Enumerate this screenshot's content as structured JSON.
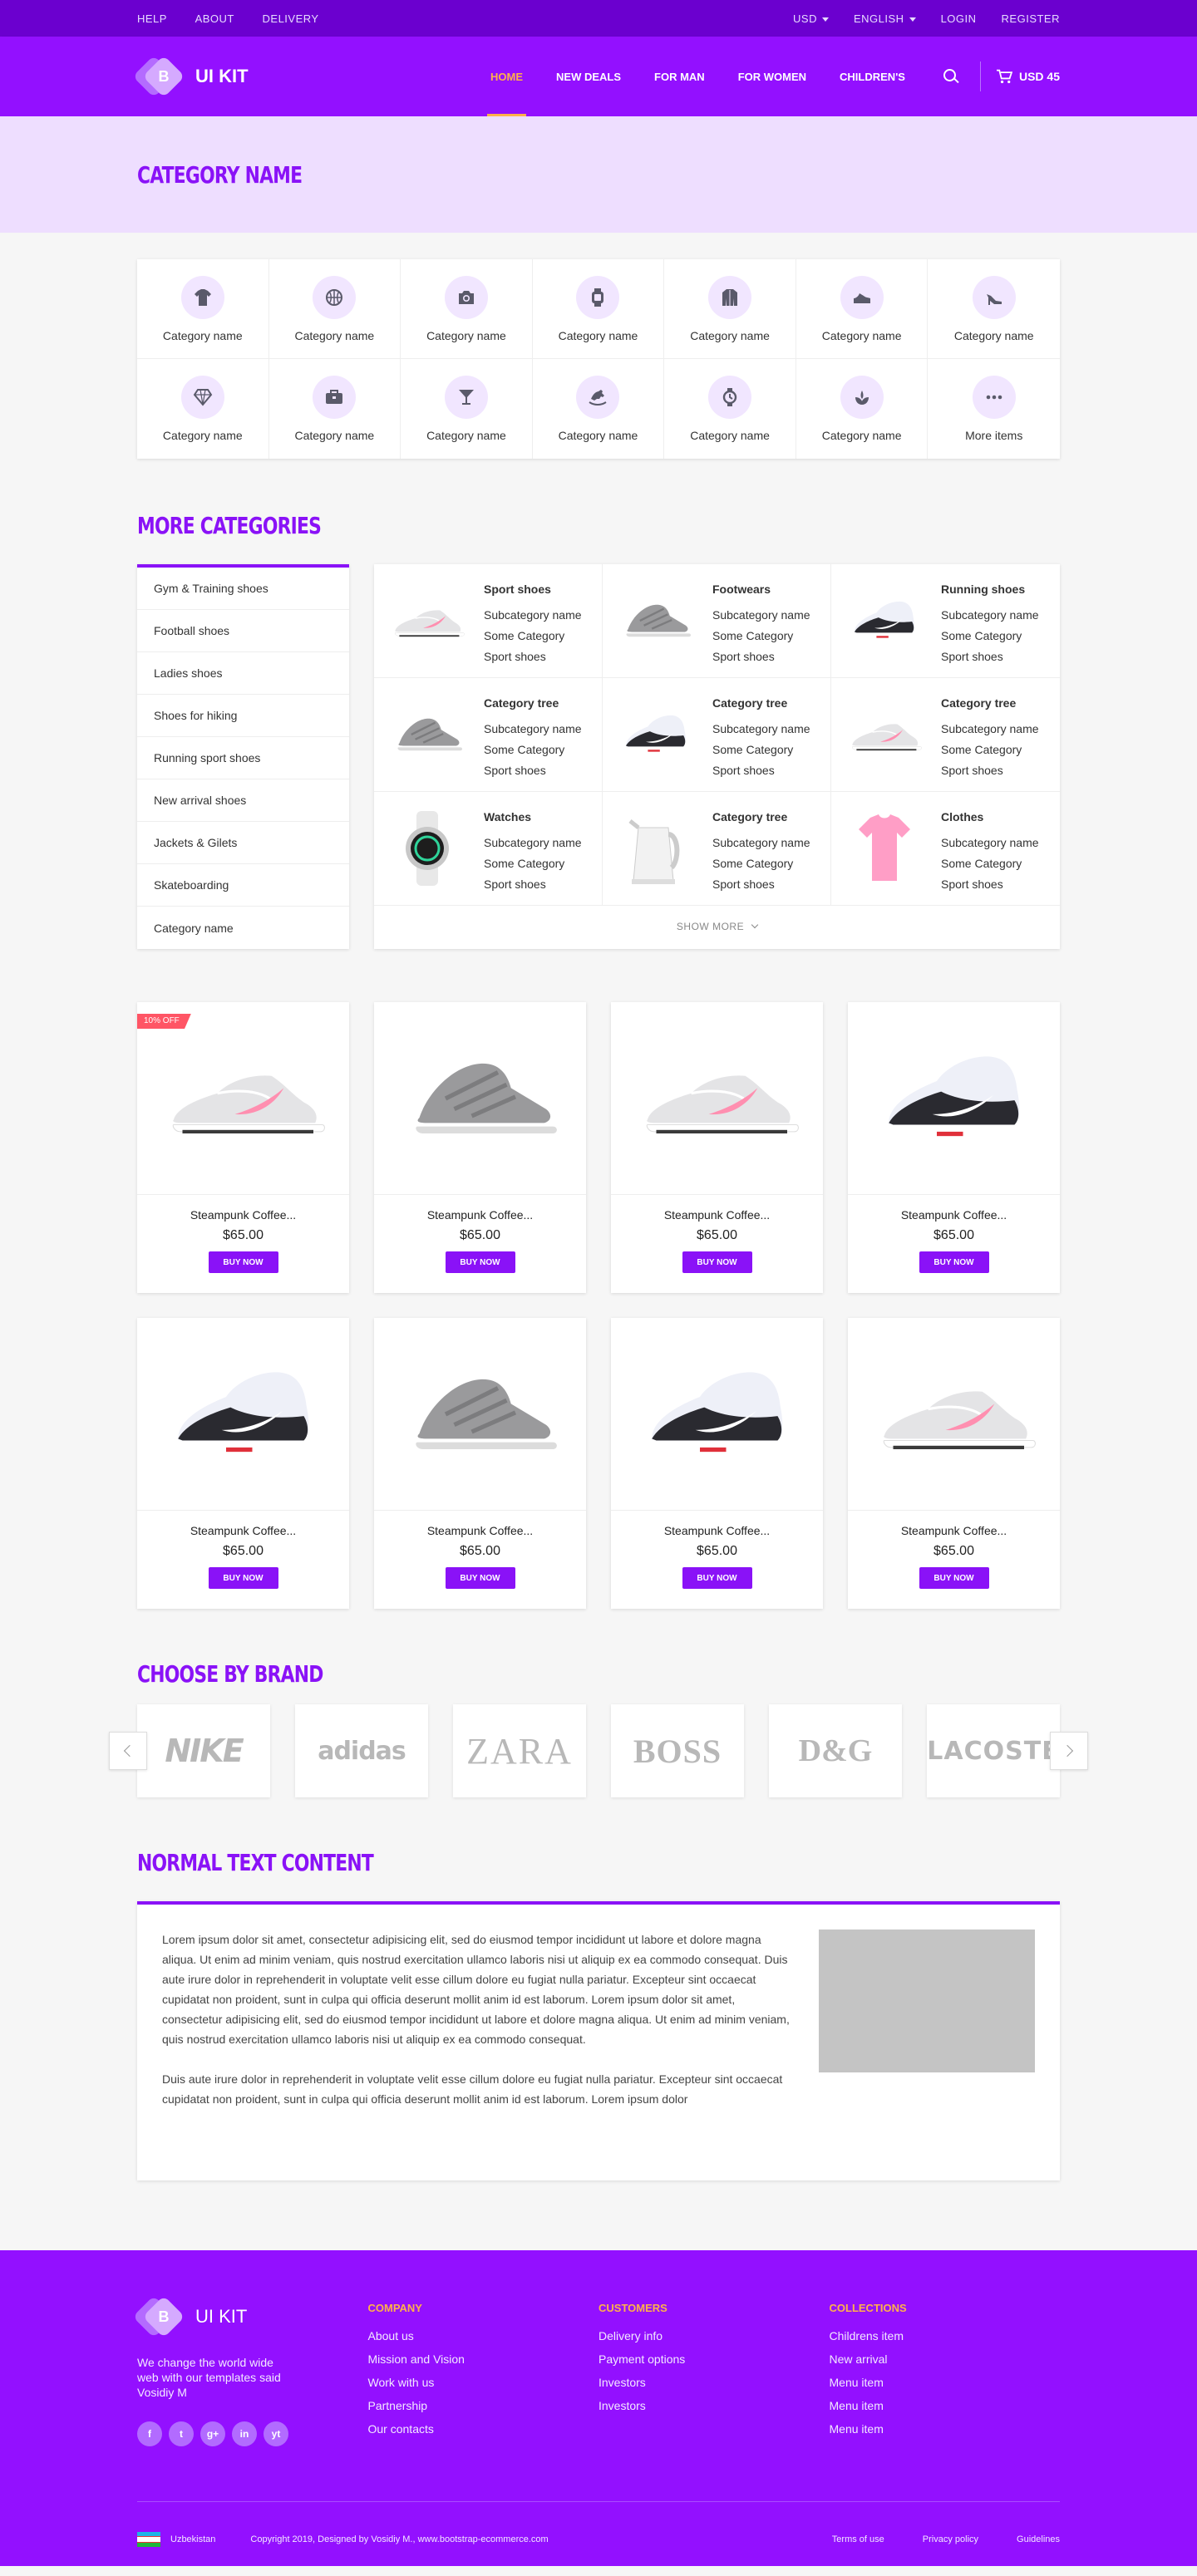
{
  "topbar": {
    "left": [
      "HELP",
      "ABOUT",
      "DELIVERY"
    ],
    "currency": "USD",
    "language": "ENGLISH",
    "login": "LOGIN",
    "register": "REGISTER"
  },
  "header": {
    "logo_letter": "B",
    "logo_text": "UI KIT",
    "nav": [
      "HOME",
      "NEW DEALS",
      "FOR MAN",
      "FOR WOMEN",
      "CHILDREN'S"
    ],
    "active_nav": "HOME",
    "cart_total": "USD 45"
  },
  "banner": {
    "title": "CATEGORY NAME"
  },
  "categories": [
    {
      "label": "Category name",
      "icon": "tshirt-icon"
    },
    {
      "label": "Category name",
      "icon": "basketball-icon"
    },
    {
      "label": "Category name",
      "icon": "camera-icon"
    },
    {
      "label": "Category name",
      "icon": "smartwatch-icon"
    },
    {
      "label": "Category name",
      "icon": "jacket-icon"
    },
    {
      "label": "Category name",
      "icon": "shoe-icon"
    },
    {
      "label": "Category name",
      "icon": "high-heel-icon"
    },
    {
      "label": "Category name",
      "icon": "diamond-icon"
    },
    {
      "label": "Category name",
      "icon": "briefcase-icon"
    },
    {
      "label": "Category name",
      "icon": "cocktail-icon"
    },
    {
      "label": "Category name",
      "icon": "rocking-horse-icon"
    },
    {
      "label": "Category name",
      "icon": "wristwatch-icon"
    },
    {
      "label": "Category name",
      "icon": "plant-icon"
    },
    {
      "label": "More items",
      "icon": "more-icon"
    }
  ],
  "more_categories": {
    "title": "MORE CATEGORIES",
    "sidebar": [
      "Gym & Training shoes",
      "Football  shoes",
      "Ladies shoes",
      "Shoes for hiking",
      "Running sport shoes",
      "New arrival shoes",
      "Jackets & Gilets",
      "Skateboarding",
      "Category name"
    ],
    "cells": [
      {
        "title": "Sport shoes",
        "lines": [
          "Subcategory name",
          "Some Category",
          "Sport shoes"
        ],
        "img": "sneaker-white"
      },
      {
        "title": "Footwears",
        "lines": [
          "Subcategory name",
          "Some Category",
          "Sport shoes"
        ],
        "img": "sneaker-grey"
      },
      {
        "title": "Running shoes",
        "lines": [
          "Subcategory name",
          "Some Category",
          "Sport shoes"
        ],
        "img": "sneaker-black"
      },
      {
        "title": "Category tree",
        "lines": [
          "Subcategory name",
          "Some Category",
          "Sport shoes"
        ],
        "img": "sneaker-grey"
      },
      {
        "title": "Category tree",
        "lines": [
          "Subcategory name",
          "Some Category",
          "Sport shoes"
        ],
        "img": "sneaker-black"
      },
      {
        "title": "Category tree",
        "lines": [
          "Subcategory name",
          "Some Category",
          "Sport shoes"
        ],
        "img": "sneaker-white"
      },
      {
        "title": "Watches",
        "lines": [
          "Subcategory name",
          "Some Category",
          "Sport shoes"
        ],
        "img": "watch"
      },
      {
        "title": "Category tree",
        "lines": [
          "Subcategory name",
          "Some Category",
          "Sport shoes"
        ],
        "img": "kettle"
      },
      {
        "title": "Clothes",
        "lines": [
          "Subcategory name",
          "Some Category",
          "Sport shoes"
        ],
        "img": "tshirt"
      }
    ],
    "show_more": "SHOW MORE"
  },
  "products": [
    {
      "name": "Steampunk Coffee...",
      "price": "$65.00",
      "button": "BUY NOW",
      "badge": "10% OFF",
      "img": "sneaker-white"
    },
    {
      "name": "Steampunk Coffee...",
      "price": "$65.00",
      "button": "BUY NOW",
      "badge": "",
      "img": "sneaker-grey"
    },
    {
      "name": "Steampunk Coffee...",
      "price": "$65.00",
      "button": "BUY NOW",
      "badge": "",
      "img": "sneaker-white"
    },
    {
      "name": "Steampunk Coffee...",
      "price": "$65.00",
      "button": "BUY NOW",
      "badge": "",
      "img": "sneaker-black"
    },
    {
      "name": "Steampunk Coffee...",
      "price": "$65.00",
      "button": "BUY NOW",
      "badge": "",
      "img": "sneaker-black"
    },
    {
      "name": "Steampunk Coffee...",
      "price": "$65.00",
      "button": "BUY NOW",
      "badge": "",
      "img": "sneaker-grey"
    },
    {
      "name": "Steampunk Coffee...",
      "price": "$65.00",
      "button": "BUY NOW",
      "badge": "",
      "img": "sneaker-black"
    },
    {
      "name": "Steampunk Coffee...",
      "price": "$65.00",
      "button": "BUY NOW",
      "badge": "",
      "img": "sneaker-white"
    }
  ],
  "brands": {
    "title": "CHOOSE BY BRAND",
    "items": [
      "NIKE",
      "adidas",
      "ZARA",
      "BOSS",
      "D&G",
      "LACOSTE"
    ]
  },
  "text_content": {
    "title": "NORMAL TEXT CONTENT",
    "p1": "Lorem ipsum dolor sit amet, consectetur adipisicing elit, sed do eiusmod tempor incididunt ut labore et dolore magna aliqua. Ut enim ad minim veniam, quis nostrud exercitation ullamco laboris nisi ut aliquip ex ea commodo consequat. Duis aute irure dolor in reprehenderit in voluptate velit esse cillum dolore eu fugiat nulla pariatur. Excepteur sint occaecat cupidatat non proident, sunt in culpa qui officia deserunt mollit anim id est laborum. Lorem ipsum dolor sit amet, consectetur adipisicing elit, sed do eiusmod tempor incididunt ut labore et dolore magna aliqua. Ut enim ad minim veniam, quis nostrud exercitation ullamco laboris nisi ut aliquip ex ea commodo consequat.",
    "p2": "Duis aute irure dolor in reprehenderit in voluptate velit esse cillum dolore eu fugiat nulla pariatur. Excepteur sint occaecat cupidatat non proident, sunt in culpa qui officia deserunt mollit anim id est laborum. Lorem ipsum dolor"
  },
  "footer": {
    "logo_text": "UI KIT",
    "description": "We change the world wide web with our templates said Vosidiy M",
    "socials": [
      "f",
      "t",
      "g+",
      "in",
      "yt"
    ],
    "columns": [
      {
        "heading": "COMPANY",
        "links": [
          "About us",
          "Mission and Vision",
          "Work with us",
          "Partnership",
          "Our contacts"
        ]
      },
      {
        "heading": "CUSTOMERS",
        "links": [
          "Delivery info",
          "Payment options",
          "Investors",
          "Investors"
        ]
      },
      {
        "heading": "COLLECTIONS",
        "links": [
          "Childrens item",
          "New arrival",
          "Menu item",
          "Menu item",
          "Menu item"
        ]
      }
    ],
    "country": "Uzbekistan",
    "copyright": "Copyright 2019,  Designed by Vosidiy M.,   www.bootstrap-ecommerce.com",
    "bottom_links": [
      "Terms of use",
      "Privacy policy",
      "Guidelines"
    ]
  },
  "colors": {
    "primary": "#9310ff",
    "dark": "#6b00cf",
    "accent": "#ffb04a",
    "badge": "#ff5565"
  }
}
